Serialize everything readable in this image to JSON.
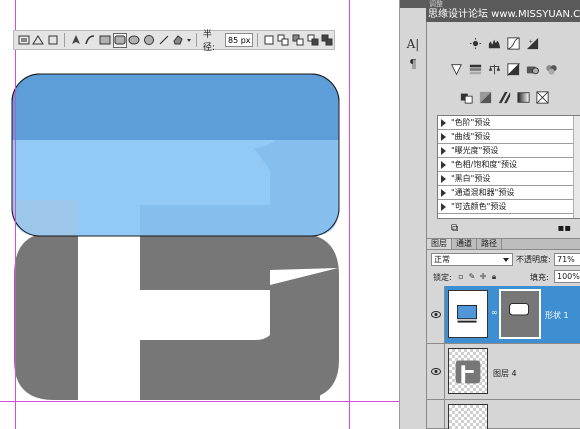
{
  "options_bar": {
    "tools": [
      "shape-layers",
      "paths",
      "fill-pixels",
      "pen",
      "freeform-pen",
      "rectangle",
      "rounded-rectangle",
      "ellipse",
      "polygon",
      "line",
      "custom-shape"
    ],
    "radius_label": "半径:",
    "radius_value": "85 px",
    "combine_modes": [
      "new",
      "add",
      "subtract",
      "intersect",
      "exclude"
    ]
  },
  "canvas": {
    "upper_shape_color": "#6fa9dc",
    "overlap_color": "#98cdf9",
    "lower_shape_color": "#777777",
    "guide_color": "#d24dd2"
  },
  "dock": {
    "icons": [
      "character-icon",
      "paragraph-icon"
    ]
  },
  "adjustments": {
    "tab_label": "调整",
    "watermark": "思缘设计论坛 www.MISSYUAN.COM",
    "row1": [
      "brightness-contrast",
      "levels",
      "curves",
      "exposure"
    ],
    "row2": [
      "vibrance",
      "hue-saturation",
      "color-balance",
      "black-white",
      "photo-filter",
      "channel-mixer"
    ],
    "row3": [
      "invert",
      "posterize",
      "threshold",
      "gradient-map",
      "selective-color"
    ],
    "presets": [
      "\"色阶\"预设",
      "\"曲线\"预设",
      "\"曝光度\"预设",
      "\"色相/饱和度\"预设",
      "\"黑白\"预设",
      "\"通道混和器\"预设",
      "\"可选颜色\"预设"
    ]
  },
  "layers_panel": {
    "tabs": [
      "图层",
      "通道",
      "路径"
    ],
    "active_tab": "图层",
    "blend_mode": "正常",
    "opacity_label": "不透明度:",
    "opacity_value": "71%",
    "lock_label": "锁定:",
    "fill_label": "填充:",
    "fill_value": "100%",
    "layers": [
      {
        "name": "形状 1",
        "selected": true
      },
      {
        "name": "图层 4",
        "selected": false
      },
      {
        "name": "",
        "selected": false
      }
    ]
  }
}
